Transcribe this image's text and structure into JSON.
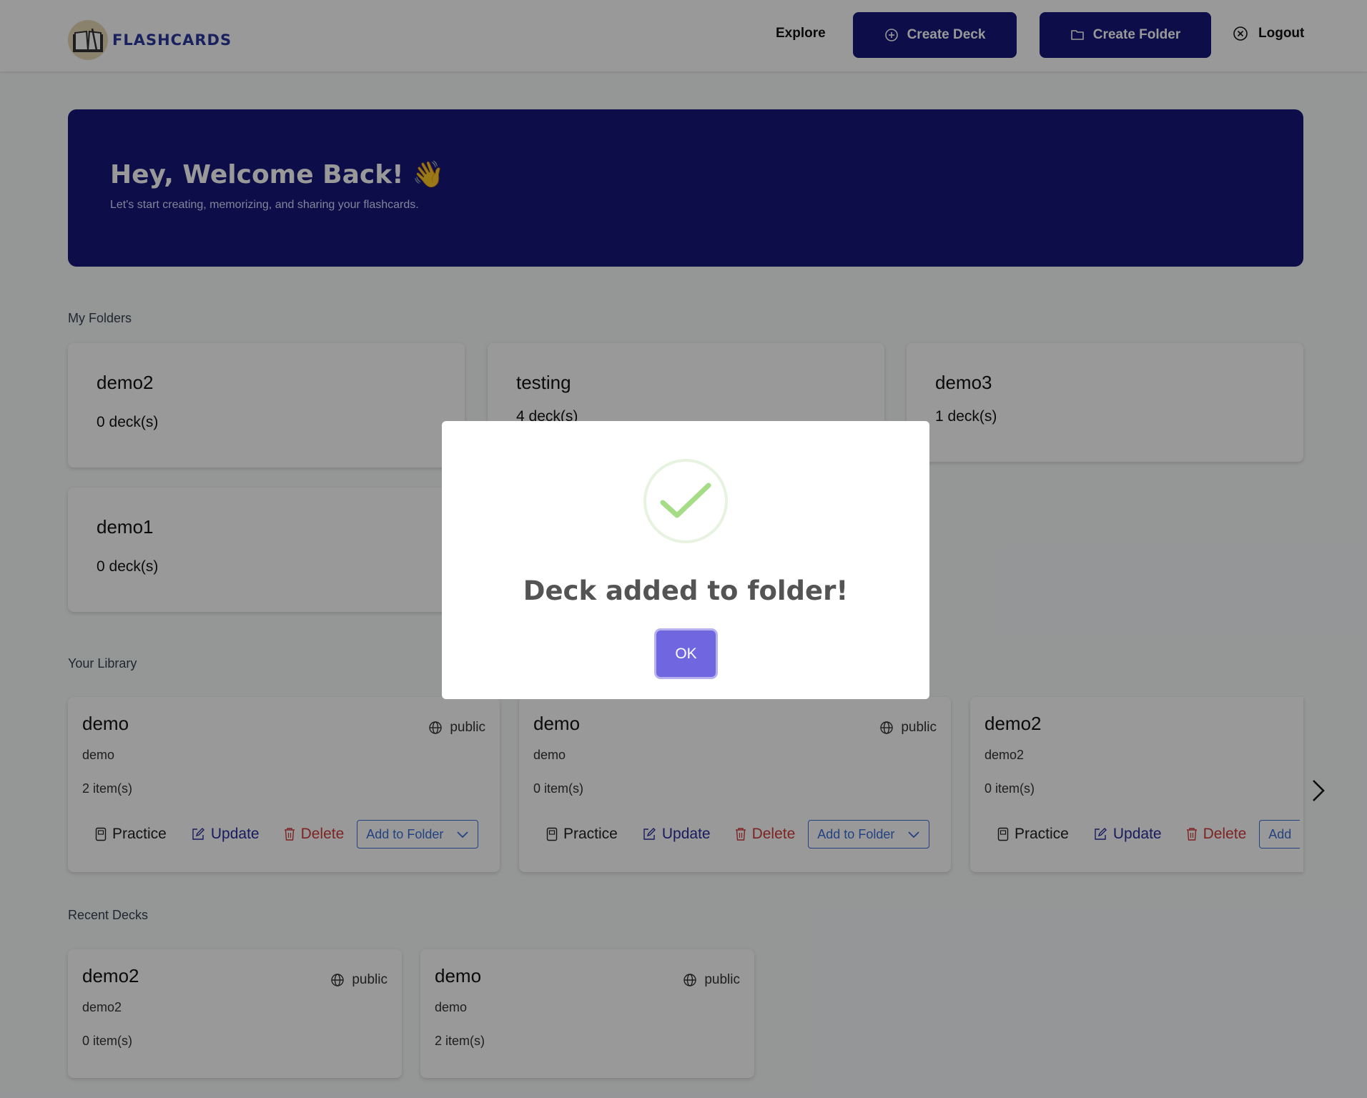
{
  "header": {
    "logo_text": "FLASHCARDS",
    "explore": "Explore",
    "create_deck": "Create Deck",
    "create_folder": "Create Folder",
    "logout": "Logout"
  },
  "hero": {
    "title": "Hey, Welcome Back!",
    "emoji": "👋",
    "subtitle": "Let's start creating, memorizing, and sharing your flashcards."
  },
  "folders": {
    "label": "My Folders",
    "items": [
      {
        "name": "demo2",
        "count": "0 deck(s)"
      },
      {
        "name": "testing",
        "count": "4 deck(s)"
      },
      {
        "name": "demo3",
        "count": "1 deck(s)"
      },
      {
        "name": "demo1",
        "count": "0 deck(s)"
      }
    ]
  },
  "library": {
    "label": "Your Library",
    "items": [
      {
        "name": "demo",
        "visibility": "public",
        "description": "demo",
        "count": "2 item(s)"
      },
      {
        "name": "demo",
        "visibility": "public",
        "description": "demo",
        "count": "0 item(s)"
      },
      {
        "name": "demo2",
        "visibility": "",
        "description": "demo2",
        "count": "0 item(s)"
      }
    ],
    "actions": {
      "practice": "Practice",
      "update": "Update",
      "delete": "Delete",
      "add_to_folder": "Add to Folder",
      "add_truncated": "Add"
    }
  },
  "recent": {
    "label": "Recent Decks",
    "items": [
      {
        "name": "demo2",
        "visibility": "public",
        "description": "demo2",
        "count": "0 item(s)"
      },
      {
        "name": "demo",
        "visibility": "public",
        "description": "demo",
        "count": "2 item(s)"
      }
    ]
  },
  "modal": {
    "title": "Deck added to folder!",
    "ok": "OK",
    "icon": "success-check-icon"
  },
  "colors": {
    "brand_navy": "#14167a",
    "modal_button": "#7066e0",
    "success_green": "#a5dc86",
    "delete_red": "#d33b3b",
    "link_blue": "#3b6fd9"
  }
}
